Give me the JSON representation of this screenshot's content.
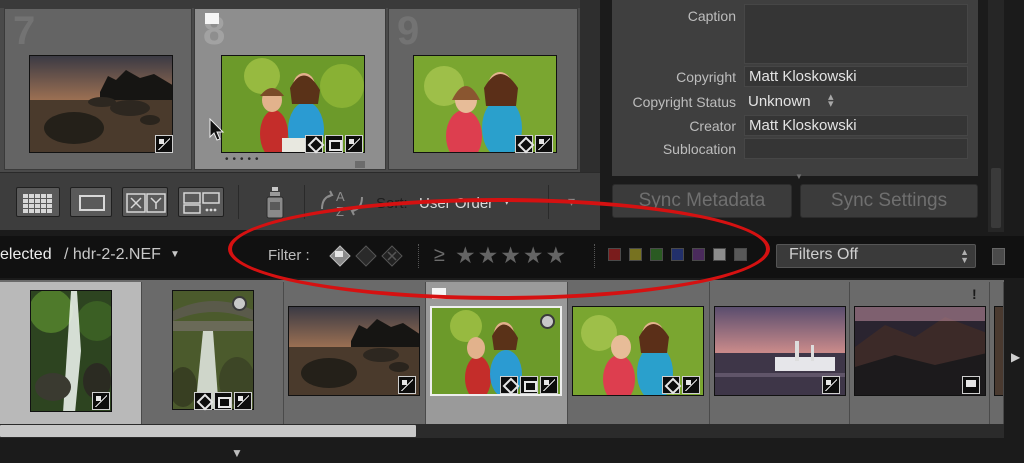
{
  "grid": {
    "cells": [
      {
        "index": "7"
      },
      {
        "index": "8"
      },
      {
        "index": "9"
      }
    ]
  },
  "toolbar": {
    "sort_label": "Sort:",
    "sort_value": "User Order"
  },
  "metadata": {
    "caption_label": "Caption",
    "copyright_label": "Copyright",
    "copyright_value": "Matt Kloskowski",
    "copyright_status_label": "Copyright Status",
    "copyright_status_value": "Unknown",
    "creator_label": "Creator",
    "creator_value": "Matt Kloskowski",
    "sublocation_label": "Sublocation"
  },
  "buttons": {
    "sync_metadata": "Sync Metadata",
    "sync_settings": "Sync Settings"
  },
  "filter_bar": {
    "selected_text": "elected",
    "file_name": "/ hdr-2-2.NEF",
    "filter_label": "Filter :",
    "gte_symbol": "≥",
    "stars": "★★★★★",
    "filters_select": "Filters Off"
  },
  "colors": {
    "highlight_oval": "#d51111",
    "label_red": "#7a1c1c",
    "label_yellow": "#777220",
    "label_green": "#2a5a22",
    "label_blue": "#22306b",
    "label_purple": "#4a2a5c",
    "label_white": "#8c8c8c",
    "label_none": "#585858"
  },
  "filmstrip": {
    "first_badge": "!"
  }
}
